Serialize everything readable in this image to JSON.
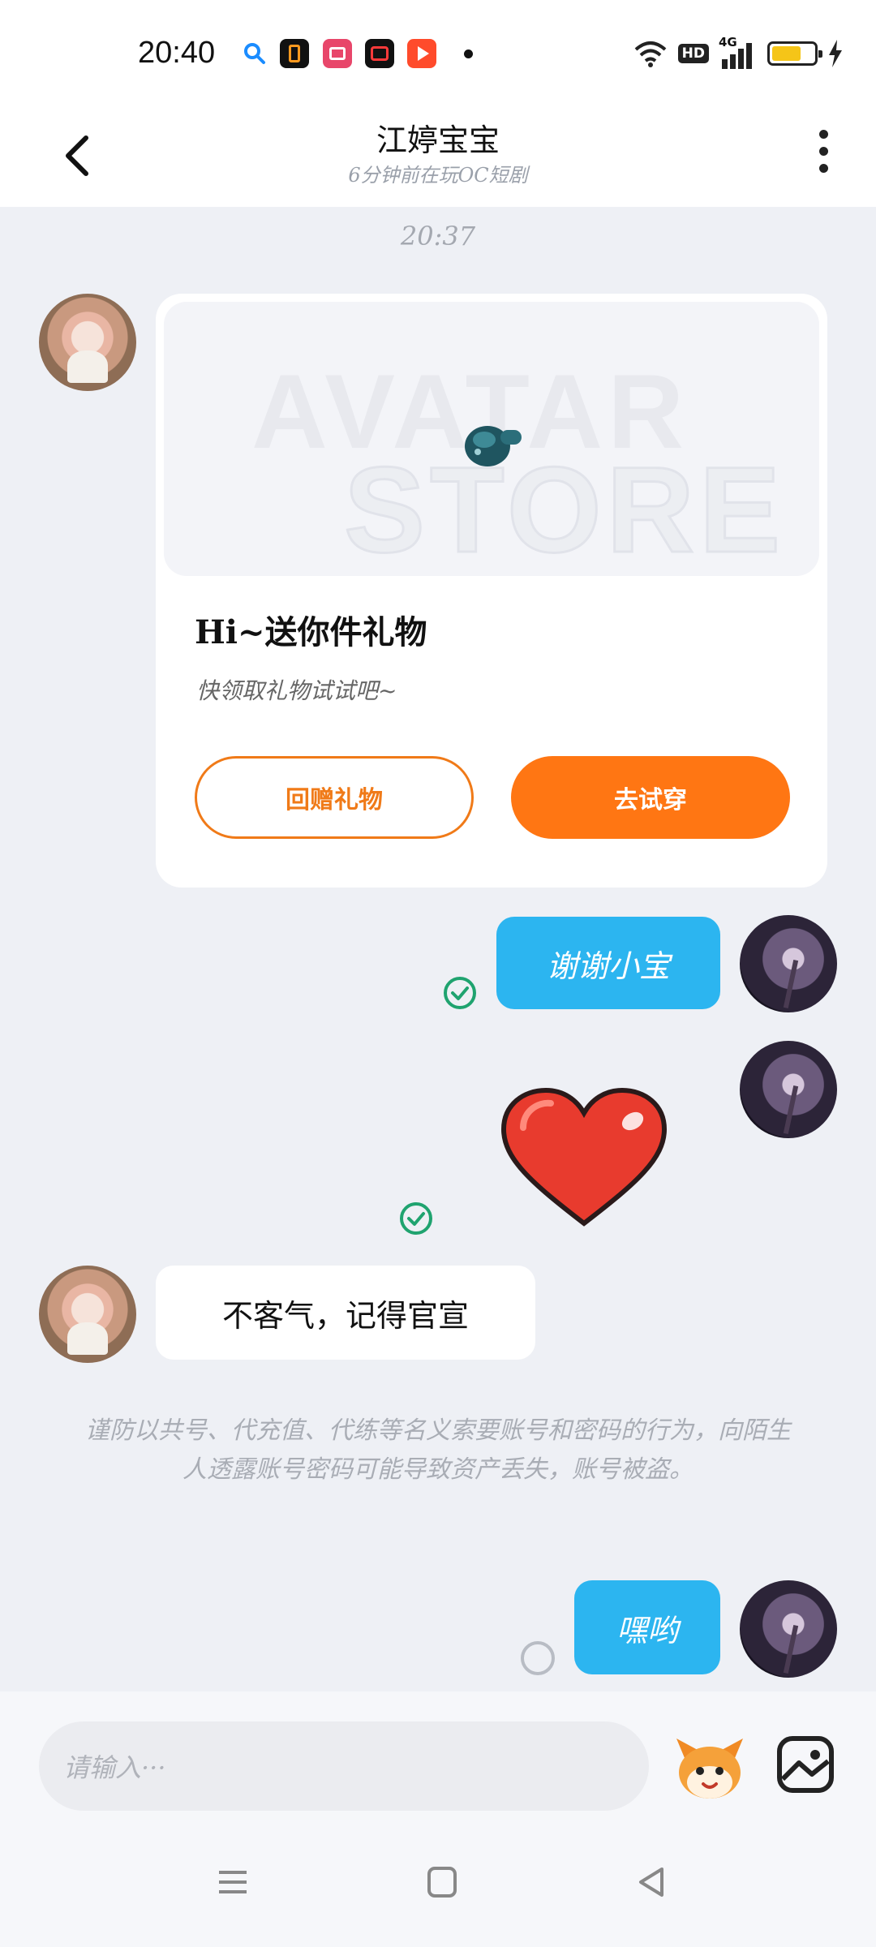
{
  "status_bar": {
    "time": "20:40",
    "network": "4G",
    "hd_label": "HD",
    "battery_level": 0.7,
    "app_icons": [
      "search-icon",
      "app-icon-black",
      "app-icon-pink",
      "app-icon-red",
      "app-icon-play"
    ]
  },
  "header": {
    "title": "江婷宝宝",
    "subtitle": "6分钟前在玩OC短剧"
  },
  "chat": {
    "timestamp": "20:37",
    "gift_card": {
      "watermark_line1": "AVATAR",
      "watermark_line2": "STORE",
      "title": "Hi~送你件礼物",
      "description": "快领取礼物试试吧~",
      "return_gift_label": "回赠礼物",
      "try_on_label": "去试穿"
    },
    "messages": [
      {
        "from": "me",
        "text": "谢谢小宝",
        "status": "read"
      },
      {
        "from": "me",
        "sticker": "heart-sticker",
        "status": "read"
      },
      {
        "from": "her",
        "text": "不客气，记得官宣"
      },
      {
        "from": "me",
        "text": "嘿哟",
        "status": "sending"
      }
    ],
    "security_notice": "谨防以共号、代充值、代练等名义索要账号和密码的行为，向陌生人透露账号密码可能导致资产丢失，账号被盗。"
  },
  "input": {
    "placeholder": "请输入···"
  },
  "colors": {
    "accent_orange": "#ff7613",
    "bubble_blue": "#2cb5f0",
    "read_check_green": "#1fa36f",
    "background": "#eef0f5"
  }
}
